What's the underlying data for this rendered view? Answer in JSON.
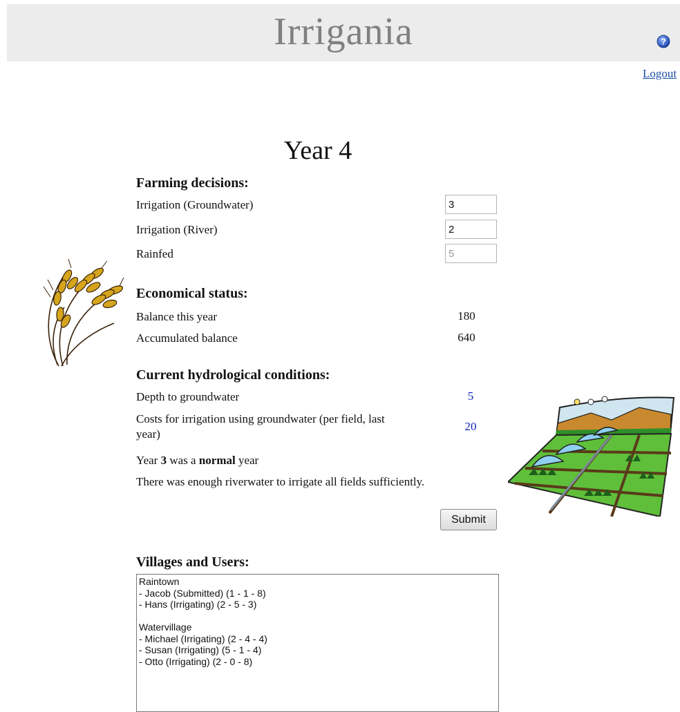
{
  "header": {
    "title": "Irrigania",
    "logout_label": "Logout"
  },
  "year_title": "Year 4",
  "farming": {
    "title": "Farming decisions:",
    "rows": [
      {
        "label": "Irrigation (Groundwater)",
        "value": "3"
      },
      {
        "label": "Irrigation (River)",
        "value": "2"
      },
      {
        "label": "Rainfed",
        "value": "5"
      }
    ]
  },
  "economic": {
    "title": "Economical status:",
    "rows": [
      {
        "label": "Balance this year",
        "value": "180"
      },
      {
        "label": "Accumulated balance",
        "value": "640"
      }
    ]
  },
  "hydro": {
    "title": "Current hydrological conditions:",
    "depth_label": "Depth to groundwater",
    "depth_value": "5",
    "cost_label_line1": "Costs for irrigation using groundwater (per field, last",
    "cost_label_line2": "year)",
    "cost_value": "20",
    "year_prefix": "Year ",
    "year_number": "3",
    "year_middle": " was a ",
    "year_type": "normal",
    "year_suffix": " year",
    "river_text": "There was enough riverwater to irrigate all fields sufficiently."
  },
  "submit_label": "Submit",
  "villages": {
    "title": "Villages and Users:",
    "groups": [
      {
        "name": "Raintown",
        "users": [
          "- Jacob (Submitted) (1 - 1 - 8)",
          "- Hans (Irrigating) (2 - 5 - 3)"
        ]
      },
      {
        "name": "Watervillage",
        "users": [
          "- Michael (Irrigating) (2 - 4 - 4)",
          "- Susan (Irrigating) (5 - 1 - 4)",
          "- Otto (Irrigating) (2 - 0 - 8)"
        ]
      }
    ]
  },
  "icons": {
    "help": "help-icon",
    "wheat": "wheat-illustration",
    "field": "irrigated-field-illustration"
  },
  "colors": {
    "header_bg": "#ececec",
    "title_text": "#808080",
    "link": "#1a4fa8",
    "blue_value": "#1424b8"
  }
}
